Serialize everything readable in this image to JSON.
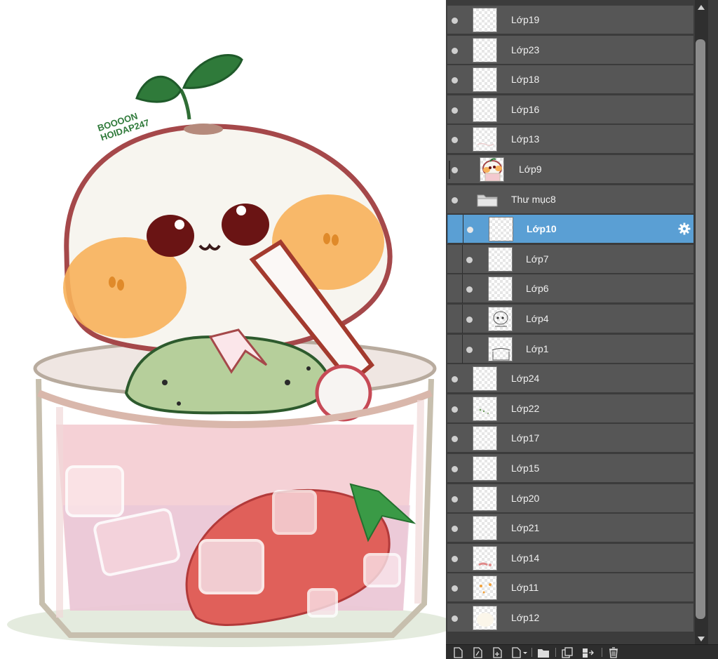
{
  "panel": {
    "layers": [
      {
        "label": "Lớp19",
        "thumb": "blank"
      },
      {
        "label": "Lớp23",
        "thumb": "blank"
      },
      {
        "label": "Lớp18",
        "thumb": "blank"
      },
      {
        "label": "Lớp16",
        "thumb": "blank"
      },
      {
        "label": "Lớp13",
        "thumb": "faint-sketch"
      },
      {
        "label": "Lớp9",
        "thumb": "character-art"
      },
      {
        "label": "Thư mục8",
        "thumb": "folder-icon"
      },
      {
        "label": "Lớp10",
        "thumb": "blank",
        "selected": true
      },
      {
        "label": "Lớp7",
        "thumb": "blank"
      },
      {
        "label": "Lớp6",
        "thumb": "blank"
      },
      {
        "label": "Lớp4",
        "thumb": "line-sketch"
      },
      {
        "label": "Lớp1",
        "thumb": "glass-lines"
      },
      {
        "label": "Lớp24",
        "thumb": "blank"
      },
      {
        "label": "Lớp22",
        "thumb": "green-dots"
      },
      {
        "label": "Lớp17",
        "thumb": "blank"
      },
      {
        "label": "Lớp15",
        "thumb": "blank"
      },
      {
        "label": "Lớp20",
        "thumb": "blank"
      },
      {
        "label": "Lớp21",
        "thumb": "blank"
      },
      {
        "label": "Lớp14",
        "thumb": "pink-mark"
      },
      {
        "label": "Lớp11",
        "thumb": "orange-dots"
      },
      {
        "label": "Lớp12",
        "thumb": "cream-fill"
      }
    ],
    "selected_layer": "Lớp10",
    "selection_color": "#5a9fd4",
    "row_color": "#565656"
  },
  "canvas": {
    "watermark_line1": "BOOOON",
    "watermark_line2": "HOIDAP247"
  },
  "toolbar": {
    "buttons": [
      "new-raster-layer-icon",
      "new-vector-layer-icon",
      "new-layer-icon",
      "new-layer-menu-icon",
      "new-folder-icon",
      "copy-layer-icon",
      "merge-layer-icon",
      "delete-layer-icon"
    ]
  }
}
